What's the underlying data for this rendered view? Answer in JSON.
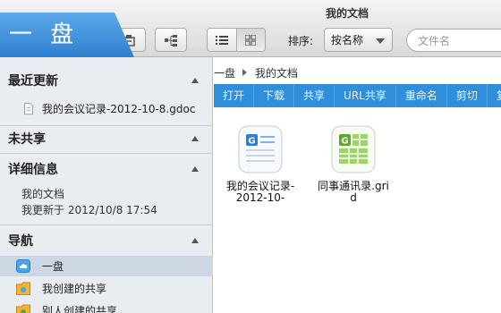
{
  "window": {
    "title": "我的文档"
  },
  "logo": {
    "text": "一 盘"
  },
  "toolbar": {
    "sort_label": "排序:",
    "sort_value": "按名称",
    "search_placeholder": "文件名"
  },
  "breadcrumb": [
    "一盘",
    "我的文档"
  ],
  "actions": [
    "打开",
    "下载",
    "共享",
    "URL共享",
    "重命名",
    "剪切",
    "复"
  ],
  "sidebar": {
    "recent": {
      "title": "最近更新",
      "items": [
        "我的会议记录-2012-10-8.gdoc"
      ]
    },
    "unshared": {
      "title": "未共享"
    },
    "details": {
      "title": "详细信息",
      "lines": [
        "我的文档",
        "我更新于 2012/10/8 17:54"
      ]
    },
    "nav": {
      "title": "导航",
      "items": [
        "一盘",
        "我创建的共享",
        "别人创建的共享"
      ]
    }
  },
  "files": [
    {
      "name_line1": "我的会议记录-",
      "name_line2": "2012-10-",
      "icon": "gdoc-document-icon",
      "color": "#2a7fd4"
    },
    {
      "name_line1": "同事通讯录.gri",
      "name_line2": "d",
      "icon": "grid-spreadsheet-icon",
      "color": "#5aaa2a"
    }
  ],
  "colors": {
    "accent": "#2f8fdb",
    "sidebar_bg": "#e9ecf1",
    "selected_row": "#cdd6e3"
  }
}
